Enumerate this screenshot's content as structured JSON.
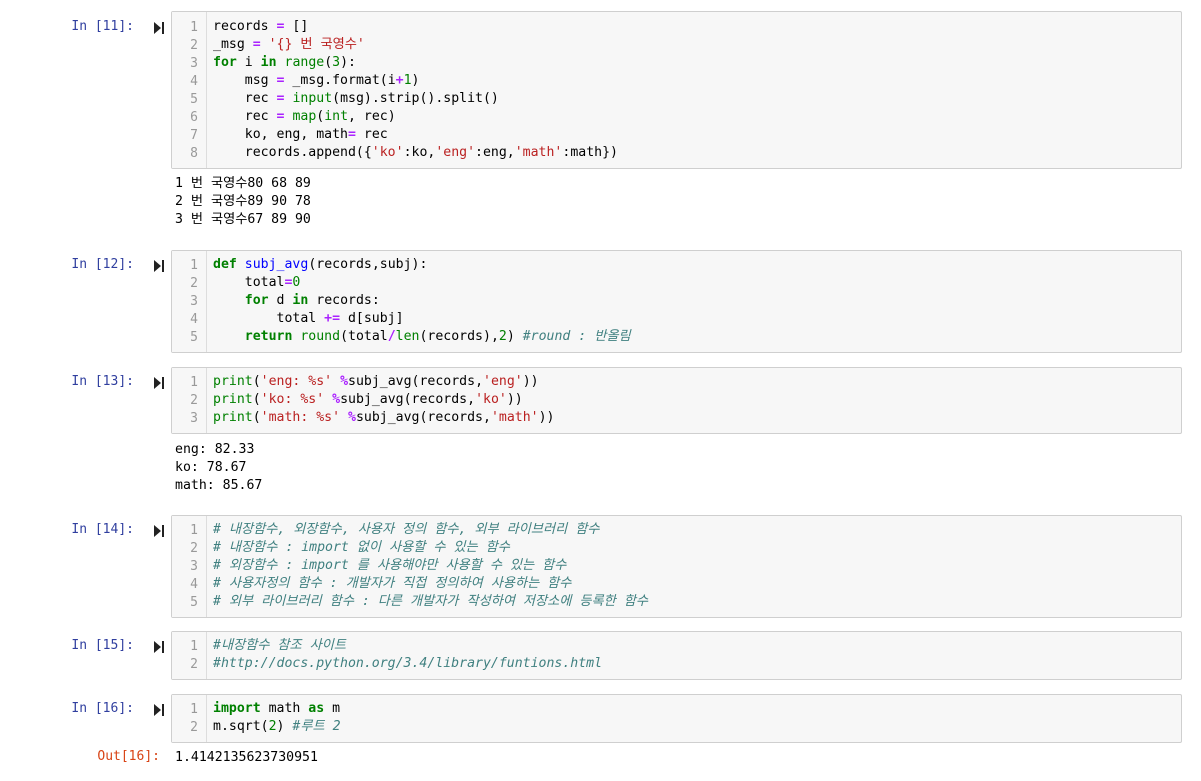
{
  "cells": [
    {
      "prompt": "In [11]:",
      "lines": [
        [
          {
            "t": "records "
          },
          {
            "t": "=",
            "c": "op"
          },
          {
            "t": " []"
          }
        ],
        [
          {
            "t": "_msg "
          },
          {
            "t": "=",
            "c": "op"
          },
          {
            "t": " "
          },
          {
            "t": "'{} 번 국영수'",
            "c": "str"
          }
        ],
        [
          {
            "t": "for",
            "c": "kw"
          },
          {
            "t": " i "
          },
          {
            "t": "in",
            "c": "kw"
          },
          {
            "t": " "
          },
          {
            "t": "range",
            "c": "bi"
          },
          {
            "t": "("
          },
          {
            "t": "3",
            "c": "num"
          },
          {
            "t": "):"
          }
        ],
        [
          {
            "t": "    msg "
          },
          {
            "t": "=",
            "c": "op"
          },
          {
            "t": " _msg.format(i"
          },
          {
            "t": "+",
            "c": "op"
          },
          {
            "t": "1",
            "c": "num"
          },
          {
            "t": ")"
          }
        ],
        [
          {
            "t": "    rec "
          },
          {
            "t": "=",
            "c": "op"
          },
          {
            "t": " "
          },
          {
            "t": "input",
            "c": "bi"
          },
          {
            "t": "(msg).strip().split()"
          }
        ],
        [
          {
            "t": "    rec "
          },
          {
            "t": "=",
            "c": "op"
          },
          {
            "t": " "
          },
          {
            "t": "map",
            "c": "bi"
          },
          {
            "t": "("
          },
          {
            "t": "int",
            "c": "bi"
          },
          {
            "t": ", rec)"
          }
        ],
        [
          {
            "t": "    ko, eng, math"
          },
          {
            "t": "=",
            "c": "op"
          },
          {
            "t": " rec"
          }
        ],
        [
          {
            "t": "    records.append({"
          },
          {
            "t": "'ko'",
            "c": "str"
          },
          {
            "t": ":ko,"
          },
          {
            "t": "'eng'",
            "c": "str"
          },
          {
            "t": ":eng,"
          },
          {
            "t": "'math'",
            "c": "str"
          },
          {
            "t": ":math})"
          }
        ]
      ],
      "output": [
        "1 번 국영수80 68 89",
        "2 번 국영수89 90 78",
        "3 번 국영수67 89 90"
      ]
    },
    {
      "prompt": "In [12]:",
      "lines": [
        [
          {
            "t": "def",
            "c": "kw"
          },
          {
            "t": " "
          },
          {
            "t": "subj_avg",
            "c": "fn"
          },
          {
            "t": "(records,subj):"
          }
        ],
        [
          {
            "t": "    total"
          },
          {
            "t": "=",
            "c": "op"
          },
          {
            "t": "0",
            "c": "num"
          }
        ],
        [
          {
            "t": "    "
          },
          {
            "t": "for",
            "c": "kw"
          },
          {
            "t": " d "
          },
          {
            "t": "in",
            "c": "kw"
          },
          {
            "t": " records:"
          }
        ],
        [
          {
            "t": "        total "
          },
          {
            "t": "+=",
            "c": "op"
          },
          {
            "t": " d[subj]"
          }
        ],
        [
          {
            "t": "    "
          },
          {
            "t": "return",
            "c": "kw"
          },
          {
            "t": " "
          },
          {
            "t": "round",
            "c": "bi"
          },
          {
            "t": "(total"
          },
          {
            "t": "/",
            "c": "op"
          },
          {
            "t": "len",
            "c": "bi"
          },
          {
            "t": "(records),"
          },
          {
            "t": "2",
            "c": "num"
          },
          {
            "t": ") "
          },
          {
            "t": "#round : 반올림",
            "c": "cm"
          }
        ]
      ],
      "output": []
    },
    {
      "prompt": "In [13]:",
      "lines": [
        [
          {
            "t": "print",
            "c": "bi"
          },
          {
            "t": "("
          },
          {
            "t": "'eng: %s'",
            "c": "str"
          },
          {
            "t": " "
          },
          {
            "t": "%",
            "c": "op"
          },
          {
            "t": "subj_avg(records,"
          },
          {
            "t": "'eng'",
            "c": "str"
          },
          {
            "t": "))"
          }
        ],
        [
          {
            "t": "print",
            "c": "bi"
          },
          {
            "t": "("
          },
          {
            "t": "'ko: %s'",
            "c": "str"
          },
          {
            "t": " "
          },
          {
            "t": "%",
            "c": "op"
          },
          {
            "t": "subj_avg(records,"
          },
          {
            "t": "'ko'",
            "c": "str"
          },
          {
            "t": "))"
          }
        ],
        [
          {
            "t": "print",
            "c": "bi"
          },
          {
            "t": "("
          },
          {
            "t": "'math: %s'",
            "c": "str"
          },
          {
            "t": " "
          },
          {
            "t": "%",
            "c": "op"
          },
          {
            "t": "subj_avg(records,"
          },
          {
            "t": "'math'",
            "c": "str"
          },
          {
            "t": "))"
          }
        ]
      ],
      "output": [
        "eng: 82.33",
        "ko: 78.67",
        "math: 85.67"
      ]
    },
    {
      "prompt": "In [14]:",
      "lines": [
        [
          {
            "t": "# 내장함수, 외장함수, 사용자 정의 함수, 외부 라이브러리 함수",
            "c": "cm"
          }
        ],
        [
          {
            "t": "# 내장함수 : import 없이 사용할 수 있는 함수",
            "c": "cm"
          }
        ],
        [
          {
            "t": "# 외장함수 : import 를 사용해야만 사용할 수 있는 함수",
            "c": "cm"
          }
        ],
        [
          {
            "t": "# 사용자정의 함수 : 개발자가 직접 정의하여 사용하는 함수",
            "c": "cm"
          }
        ],
        [
          {
            "t": "# 외부 라이브러리 함수 : 다른 개발자가 작성하여 저장소에 등록한 함수",
            "c": "cm"
          }
        ]
      ],
      "output": []
    },
    {
      "prompt": "In [15]:",
      "lines": [
        [
          {
            "t": "#내장함수 참조 사이트",
            "c": "cm"
          }
        ],
        [
          {
            "t": "#http://docs.python.org/3.4/library/funtions.html",
            "c": "cm"
          }
        ]
      ],
      "output": []
    },
    {
      "prompt": "In [16]:",
      "lines": [
        [
          {
            "t": "import",
            "c": "kw"
          },
          {
            "t": " math "
          },
          {
            "t": "as",
            "c": "kw"
          },
          {
            "t": " m"
          }
        ],
        [
          {
            "t": "m.sqrt("
          },
          {
            "t": "2",
            "c": "num"
          },
          {
            "t": ") "
          },
          {
            "t": "#루트 2",
            "c": "cm"
          }
        ]
      ],
      "output": [],
      "out_prompt": "Out[16]:",
      "out_value": "1.4142135623730951"
    }
  ]
}
